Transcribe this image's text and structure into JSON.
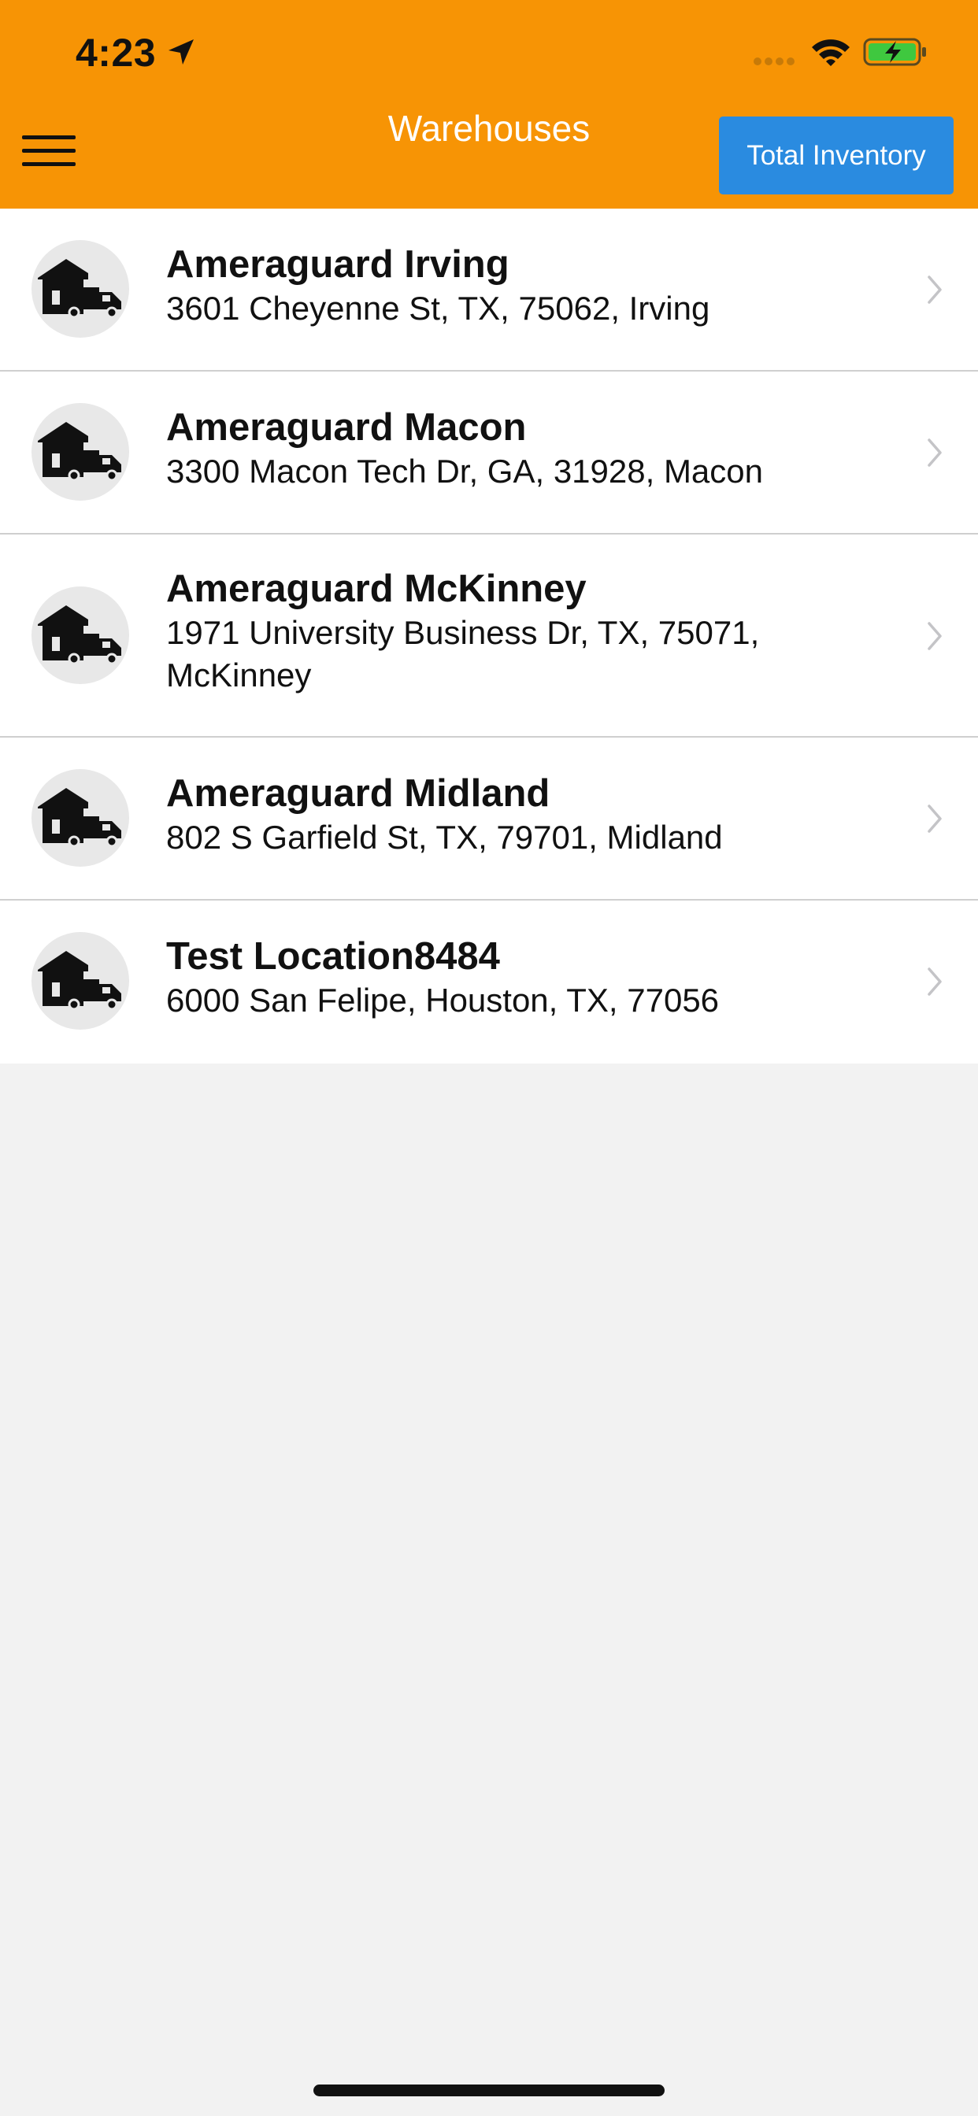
{
  "status_bar": {
    "time": "4:23"
  },
  "header": {
    "title": "Warehouses",
    "total_inventory_label": "Total Inventory"
  },
  "colors": {
    "header_bg": "#f79405",
    "button_bg": "#2a8be0",
    "list_bg": "#ffffff",
    "page_bg": "#f2f2f2"
  },
  "warehouses": [
    {
      "name": "Ameraguard Irving",
      "address": "3601 Cheyenne St, TX, 75062, Irving"
    },
    {
      "name": "Ameraguard Macon",
      "address": "3300 Macon Tech Dr, GA, 31928, Macon"
    },
    {
      "name": "Ameraguard McKinney",
      "address": "1971 University Business Dr, TX, 75071, McKinney"
    },
    {
      "name": "Ameraguard Midland",
      "address": "802 S Garfield St, TX, 79701, Midland"
    },
    {
      "name": "Test Location8484",
      "address": "6000 San Felipe, Houston, TX, 77056"
    }
  ],
  "icons": {
    "row_icon": "warehouse-truck-icon",
    "row_disclosure": "chevron-right-icon"
  }
}
